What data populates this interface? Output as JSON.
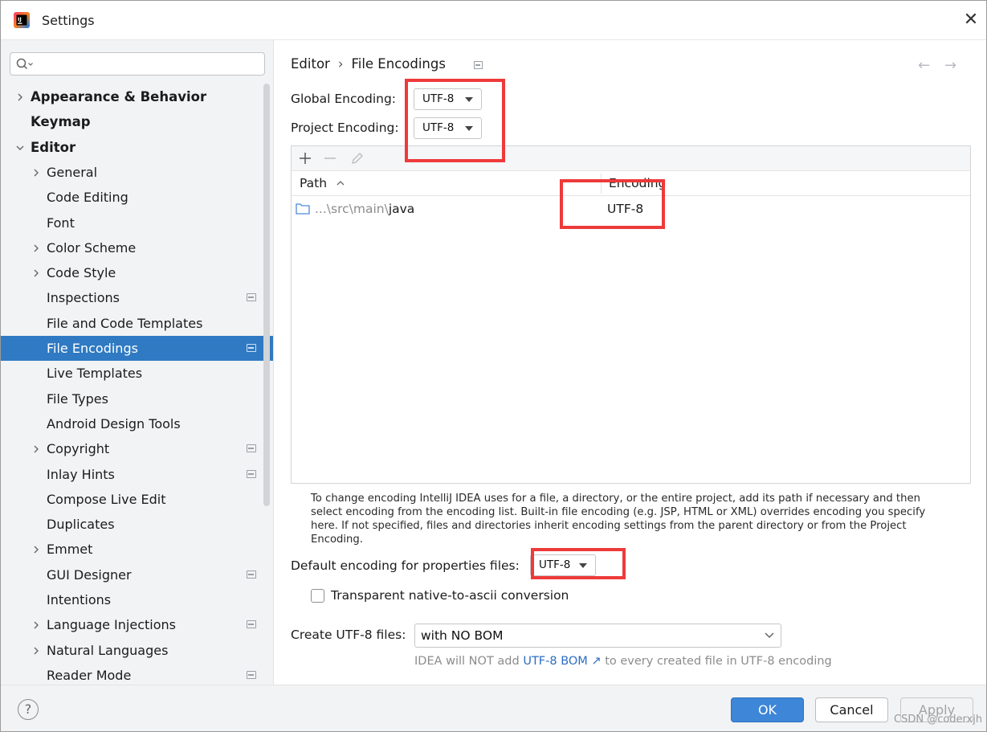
{
  "window": {
    "title": "Settings"
  },
  "sidebar": {
    "search_placeholder": "",
    "items": [
      {
        "label": "Appearance & Behavior",
        "level": 0,
        "expandable": true,
        "expanded": false,
        "icon": ""
      },
      {
        "label": "Keymap",
        "level": 0,
        "expandable": false,
        "icon": ""
      },
      {
        "label": "Editor",
        "level": 0,
        "expandable": true,
        "expanded": true,
        "icon": ""
      },
      {
        "label": "General",
        "level": 1,
        "expandable": true,
        "expanded": false,
        "icon": ""
      },
      {
        "label": "Code Editing",
        "level": 1,
        "expandable": false,
        "icon": ""
      },
      {
        "label": "Font",
        "level": 1,
        "expandable": false,
        "icon": ""
      },
      {
        "label": "Color Scheme",
        "level": 1,
        "expandable": true,
        "expanded": false,
        "icon": ""
      },
      {
        "label": "Code Style",
        "level": 1,
        "expandable": true,
        "expanded": false,
        "icon": ""
      },
      {
        "label": "Inspections",
        "level": 1,
        "expandable": false,
        "icon": "project-icon"
      },
      {
        "label": "File and Code Templates",
        "level": 1,
        "expandable": false,
        "icon": ""
      },
      {
        "label": "File Encodings",
        "level": 1,
        "expandable": false,
        "icon": "project-icon",
        "selected": true
      },
      {
        "label": "Live Templates",
        "level": 1,
        "expandable": false,
        "icon": ""
      },
      {
        "label": "File Types",
        "level": 1,
        "expandable": false,
        "icon": ""
      },
      {
        "label": "Android Design Tools",
        "level": 1,
        "expandable": false,
        "icon": ""
      },
      {
        "label": "Copyright",
        "level": 1,
        "expandable": true,
        "expanded": false,
        "icon": "project-icon"
      },
      {
        "label": "Inlay Hints",
        "level": 1,
        "expandable": false,
        "icon": "project-icon"
      },
      {
        "label": "Compose Live Edit",
        "level": 1,
        "expandable": false,
        "icon": ""
      },
      {
        "label": "Duplicates",
        "level": 1,
        "expandable": false,
        "icon": ""
      },
      {
        "label": "Emmet",
        "level": 1,
        "expandable": true,
        "expanded": false,
        "icon": ""
      },
      {
        "label": "GUI Designer",
        "level": 1,
        "expandable": false,
        "icon": "project-icon"
      },
      {
        "label": "Intentions",
        "level": 1,
        "expandable": false,
        "icon": ""
      },
      {
        "label": "Language Injections",
        "level": 1,
        "expandable": true,
        "expanded": false,
        "icon": "project-icon"
      },
      {
        "label": "Natural Languages",
        "level": 1,
        "expandable": true,
        "expanded": false,
        "icon": ""
      },
      {
        "label": "Reader Mode",
        "level": 1,
        "expandable": false,
        "icon": "project-icon"
      }
    ]
  },
  "main": {
    "breadcrumb": {
      "parent": "Editor",
      "separator": "›",
      "current": "File Encodings"
    },
    "back_arrow": "←",
    "forward_arrow": "→",
    "global_encoding_label": "Global Encoding:",
    "global_encoding_value": "UTF-8",
    "project_encoding_label": "Project Encoding:",
    "project_encoding_value": "UTF-8",
    "table": {
      "columns": [
        "Path",
        "Encoding"
      ],
      "sort_indicator": "^",
      "rows": [
        {
          "path_prefix": "...\\src\\main\\",
          "path_name": "java",
          "encoding": "UTF-8"
        }
      ]
    },
    "note": "To change encoding IntelliJ IDEA uses for a file, a directory, or the entire project, add its path if necessary and then select encoding from the encoding list. Built-in file encoding (e.g. JSP, HTML or XML) overrides encoding you specify here. If not specified, files and directories inherit encoding settings from the parent directory or from the Project Encoding.",
    "properties_label": "Default encoding for properties files:",
    "properties_value": "UTF-8",
    "native_to_ascii_label": "Transparent native-to-ascii conversion",
    "native_to_ascii_checked": false,
    "create_utf8_label": "Create UTF-8 files:",
    "create_utf8_value": "with NO BOM",
    "hint_prefix": "IDEA will NOT add",
    "hint_link": "UTF-8 BOM",
    "hint_link_arrow": "↗",
    "hint_suffix": "to every created file in UTF-8 encoding"
  },
  "footer": {
    "help_label": "?",
    "ok_label": "OK",
    "cancel_label": "Cancel",
    "apply_label": "Apply",
    "watermark": "CSDN @coderxjh"
  },
  "colors": {
    "selection": "#2f7ac3",
    "highlight_box": "#ee3a3a",
    "ok_button": "#3d86d8",
    "link": "#2b6cc4"
  }
}
